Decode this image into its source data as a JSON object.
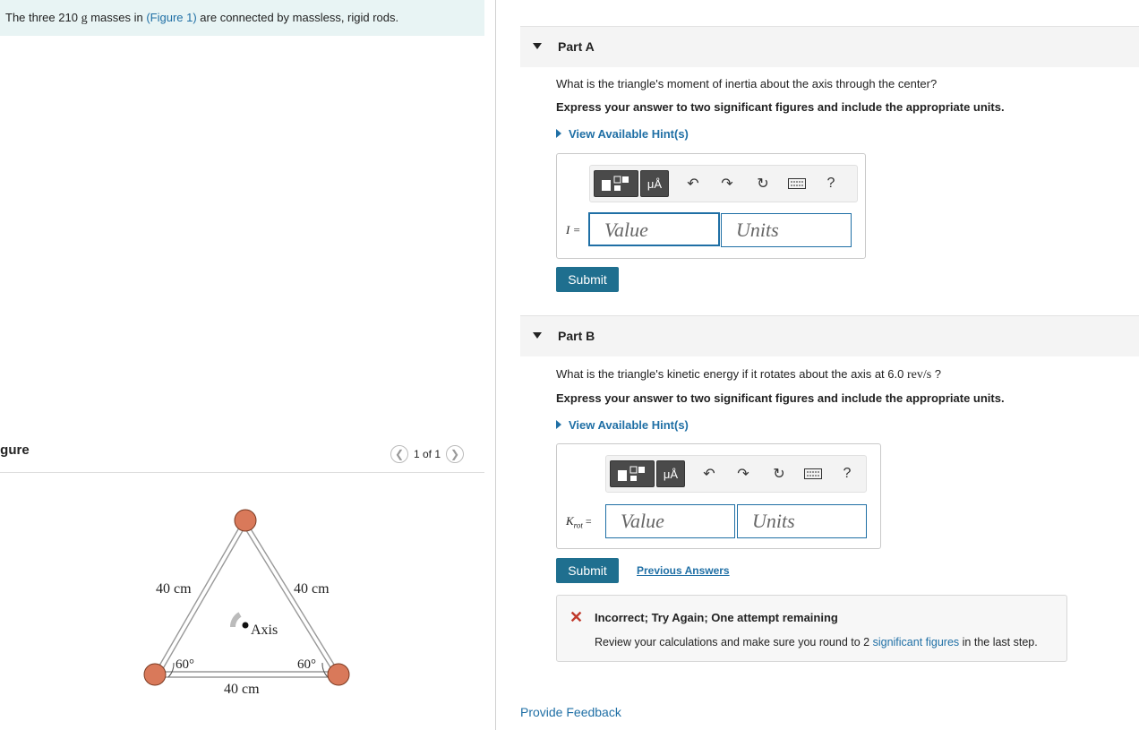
{
  "problem": {
    "prefix": "The three 210",
    "mass_unit": "g",
    "middle": " masses in ",
    "figure_link": "(Figure 1)",
    "suffix": " are connected by massless, rigid rods."
  },
  "figure": {
    "title": "igure",
    "pager_text": "1 of 1",
    "prev_icon": "chevron-left-icon",
    "next_icon": "chevron-right-icon",
    "labels": {
      "left_side": "40 cm",
      "right_side": "40 cm",
      "bottom_side": "40 cm",
      "left_angle": "60°",
      "right_angle": "60°",
      "axis": "Axis"
    }
  },
  "part_a": {
    "title": "Part A",
    "question": "What is the triangle's moment of inertia about the axis through the center?",
    "instruction": "Express your answer to two significant figures and include the appropriate units.",
    "hint_link": "View Available Hint(s)",
    "variable": "I =",
    "value_placeholder": "Value",
    "units_placeholder": "Units",
    "submit": "Submit"
  },
  "part_b": {
    "title": "Part B",
    "question_prefix": "What is the triangle's kinetic energy if it rotates about the axis at 6.0 ",
    "question_unit": "rev/s",
    "question_suffix": " ?",
    "instruction": "Express your answer to two significant figures and include the appropriate units.",
    "hint_link": "View Available Hint(s)",
    "variable_main": "K",
    "variable_sub": "rot",
    "variable_eq": " =",
    "value_placeholder": "Value",
    "units_placeholder": "Units",
    "submit": "Submit",
    "previous_answers": "Previous Answers"
  },
  "toolbar": {
    "units_button": "μÅ",
    "help": "?"
  },
  "feedback": {
    "title": "Incorrect; Try Again; One attempt remaining",
    "message_prefix": "Review your calculations and make sure you round to 2 ",
    "message_link": "significant figures",
    "message_suffix": " in the last step."
  },
  "footer": {
    "provide_feedback": "Provide Feedback"
  },
  "colors": {
    "accent": "#1f6fa5",
    "submit": "#1f6f8f",
    "banner": "#e8f4f4",
    "error": "#c0392b",
    "mass": "#d9795a"
  }
}
